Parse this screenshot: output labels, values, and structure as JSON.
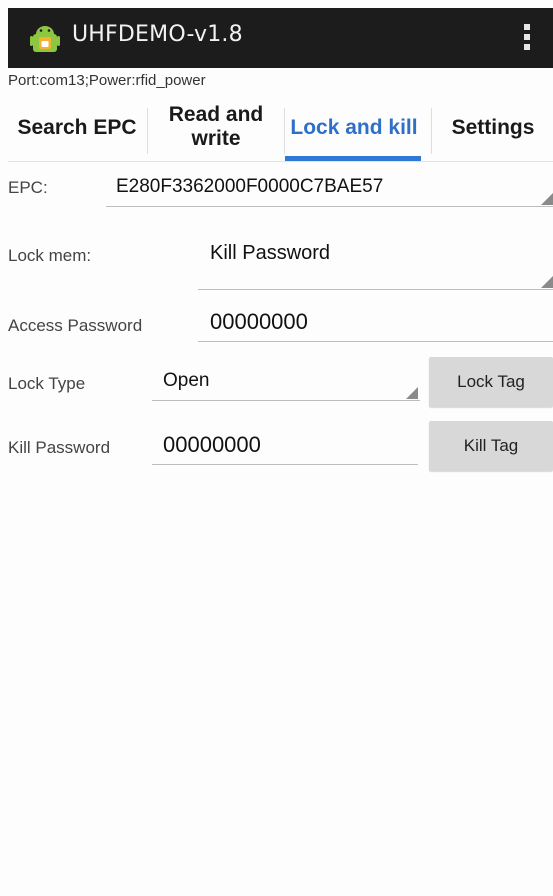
{
  "app": {
    "title": "UHFDEMO-v1.8",
    "icon": "android-app-icon",
    "menu_icon": "overflow-menu-icon"
  },
  "status": {
    "port_line": "Port:com13;Power:rfid_power"
  },
  "tabs": [
    {
      "label": "Search EPC",
      "active": false
    },
    {
      "label": "Read and write",
      "active": false
    },
    {
      "label": "Lock and kill",
      "active": true
    },
    {
      "label": "Settings",
      "active": false
    }
  ],
  "form": {
    "epc": {
      "label": "EPC:",
      "value": "E280F3362000F0000C7BAE57"
    },
    "lock_mem": {
      "label": "Lock mem:",
      "value": "Kill Password"
    },
    "access_password": {
      "label": "Access Password",
      "value": "00000000"
    },
    "lock_type": {
      "label": "Lock Type",
      "value": "Open"
    },
    "kill_password": {
      "label": "Kill Password",
      "value": "00000000"
    }
  },
  "buttons": {
    "lock_tag": "Lock Tag",
    "kill_tag": "Kill Tag"
  },
  "colors": {
    "accent": "#2f78d4",
    "titlebar": "#1c1c1c",
    "button": "#d8d8d8"
  }
}
